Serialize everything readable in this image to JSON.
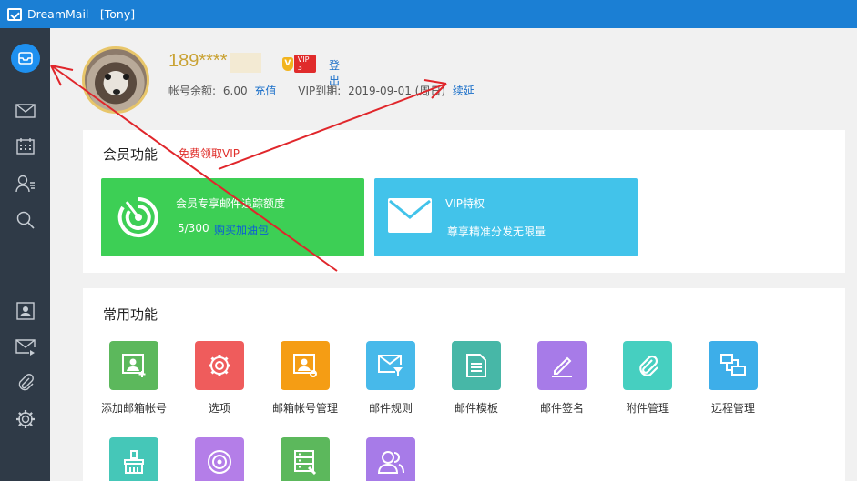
{
  "window": {
    "title": "DreamMail - [Tony]"
  },
  "sidebar": {
    "items": [
      {
        "name": "account",
        "icon": "mailbox-icon"
      },
      {
        "name": "inbox",
        "icon": "mail-icon"
      },
      {
        "name": "calendar",
        "icon": "calendar-icon"
      },
      {
        "name": "contacts",
        "icon": "contacts-icon"
      },
      {
        "name": "search",
        "icon": "search-icon"
      },
      {
        "name": "address-card",
        "icon": "id-card-icon"
      },
      {
        "name": "send-mail",
        "icon": "send-mail-icon"
      },
      {
        "name": "attachments",
        "icon": "paperclip-icon"
      },
      {
        "name": "settings",
        "icon": "gear-icon"
      }
    ]
  },
  "profile": {
    "username": "189****      1",
    "vip_v": "V",
    "vip_level": "VIP 3",
    "login": "登出",
    "balance_label": "帐号余额:",
    "balance_value": "6.00",
    "recharge": "充值",
    "vip_expire_label": "VIP到期:",
    "vip_expire_value": "2019-09-01 (周日)",
    "renew": "续延"
  },
  "member": {
    "title": "会员功能",
    "free_vip": "免费领取VIP",
    "tile_track": {
      "title": "会员专享邮件追踪额度",
      "count": "5/300",
      "buy": "购买加油包"
    },
    "tile_vip": {
      "title": "VIP特权",
      "desc": "尊享精准分发无限量"
    }
  },
  "common": {
    "title": "常用功能",
    "functions": [
      {
        "label": "添加邮箱帐号",
        "color": "#5cb85c",
        "icon": "add-account-icon"
      },
      {
        "label": "选项",
        "color": "#ef5c5c",
        "icon": "gear-icon"
      },
      {
        "label": "邮箱帐号管理",
        "color": "#f59d14",
        "icon": "account-manage-icon"
      },
      {
        "label": "邮件规则",
        "color": "#47b9ea",
        "icon": "mail-filter-icon"
      },
      {
        "label": "邮件模板",
        "color": "#47b7a7",
        "icon": "document-icon"
      },
      {
        "label": "邮件签名",
        "color": "#a77be8",
        "icon": "pen-icon"
      },
      {
        "label": "附件管理",
        "color": "#46cfc0",
        "icon": "paperclip-icon"
      },
      {
        "label": "远程管理",
        "color": "#3daee9",
        "icon": "remote-icon"
      },
      {
        "label": "",
        "color": "#45c7b8",
        "icon": "brush-icon"
      },
      {
        "label": "",
        "color": "#b47ee8",
        "icon": "target-icon"
      },
      {
        "label": "",
        "color": "#5cb85c",
        "icon": "server-tool-icon"
      },
      {
        "label": "",
        "color": "#a77be8",
        "icon": "users-icon"
      }
    ]
  }
}
